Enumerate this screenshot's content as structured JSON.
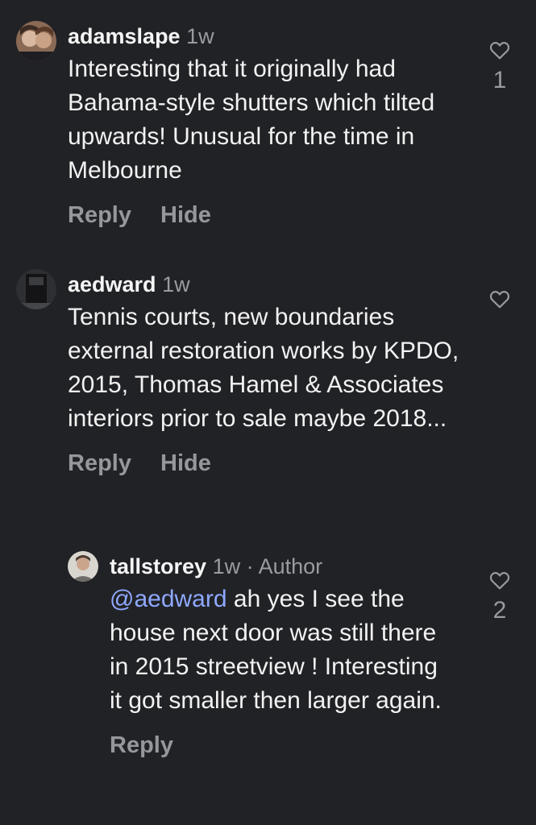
{
  "comments": [
    {
      "username": "adamslape",
      "time": "1w",
      "text": "Interesting that it originally had Bahama-style shutters which tilted upwards! Unusual for the time in Melbourne",
      "reply_label": "Reply",
      "hide_label": "Hide",
      "like_count": "1",
      "avatar_icon": "profile-photo-icon"
    },
    {
      "username": "aedward",
      "time": "1w",
      "text": "Tennis courts, new boundaries external restoration works by KPDO, 2015, Thomas Hamel & Associates interiors prior to sale maybe 2018...",
      "reply_label": "Reply",
      "hide_label": "Hide",
      "like_count": "",
      "avatar_icon": "profile-photo-icon"
    },
    {
      "username": "tallstorey",
      "time": "1w",
      "separator": "·",
      "author_badge": "Author",
      "mention": "@aedward",
      "text": "ah yes I see the house next door was still there in 2015 streetview ! Interesting it got smaller then larger  again.",
      "reply_label": "Reply",
      "like_count": "2",
      "avatar_icon": "profile-photo-icon"
    }
  ],
  "colors": {
    "background": "#212226",
    "text": "#f2f2f2",
    "muted": "#9a9ba0",
    "mention": "#8fa8ff"
  }
}
